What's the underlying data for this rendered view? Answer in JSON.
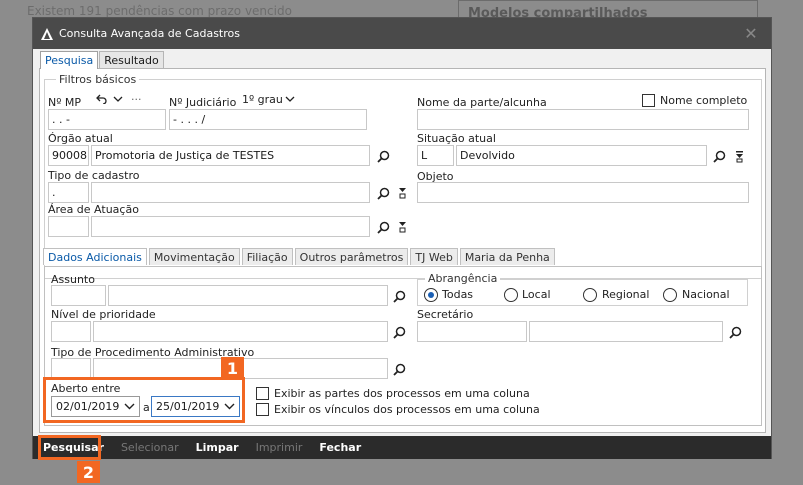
{
  "background": {
    "notice": "Existem 191 pendências com prazo vencido",
    "right_title": "Modelos compartilhados"
  },
  "dialog": {
    "title": "Consulta Avançada de Cadastros",
    "tabs": [
      "Pesquisa",
      "Resultado"
    ],
    "basic_filters": {
      "legend": "Filtros básicos",
      "mp_label": "Nº MP",
      "mp_value": ".     .     -",
      "mp_more": "···",
      "judicial_label": "Nº Judiciário",
      "degree_value": "1º grau",
      "judicial_value": "-     .     .     .     /",
      "party_label": "Nome da parte/alcunha",
      "party_value": "",
      "full_name_label": "Nome completo",
      "organ_label": "Órgão atual",
      "organ_code": "90008",
      "organ_name": "Promotoria de Justiça de TESTES",
      "situation_label": "Situação atual",
      "situation_code": "L",
      "situation_name": "Devolvido",
      "type_label": "Tipo de cadastro",
      "type_code": ".",
      "type_name": "",
      "object_label": "Objeto",
      "object_value": "",
      "area_label": "Área de Atuação",
      "area_code": "",
      "area_name": ""
    },
    "inner_tabs": [
      "Dados Adicionais",
      "Movimentação",
      "Filiação",
      "Outros parâmetros",
      "TJ Web",
      "Maria da Penha"
    ],
    "additional": {
      "subject_label": "Assunto",
      "scope_legend": "Abrangência",
      "scope_options": [
        "Todas",
        "Local",
        "Regional",
        "Nacional"
      ],
      "priority_label": "Nível de prioridade",
      "secretary_label": "Secretário",
      "procedure_label": "Tipo de Procedimento Administrativo",
      "open_between_label": "Aberto entre",
      "date_from": "02/01/2019",
      "date_sep": "a",
      "date_to": "25/01/2019",
      "show_parties_label": "Exibir as partes dos processos em uma coluna",
      "show_links_label": "Exibir os vínculos dos processos em uma coluna"
    },
    "footer": {
      "search": "Pesquisar",
      "select": "Selecionar",
      "clear": "Limpar",
      "print": "Imprimir",
      "close": "Fechar"
    }
  },
  "annotations": {
    "badge1": "1",
    "badge2": "2",
    "accent": "#f26722"
  }
}
